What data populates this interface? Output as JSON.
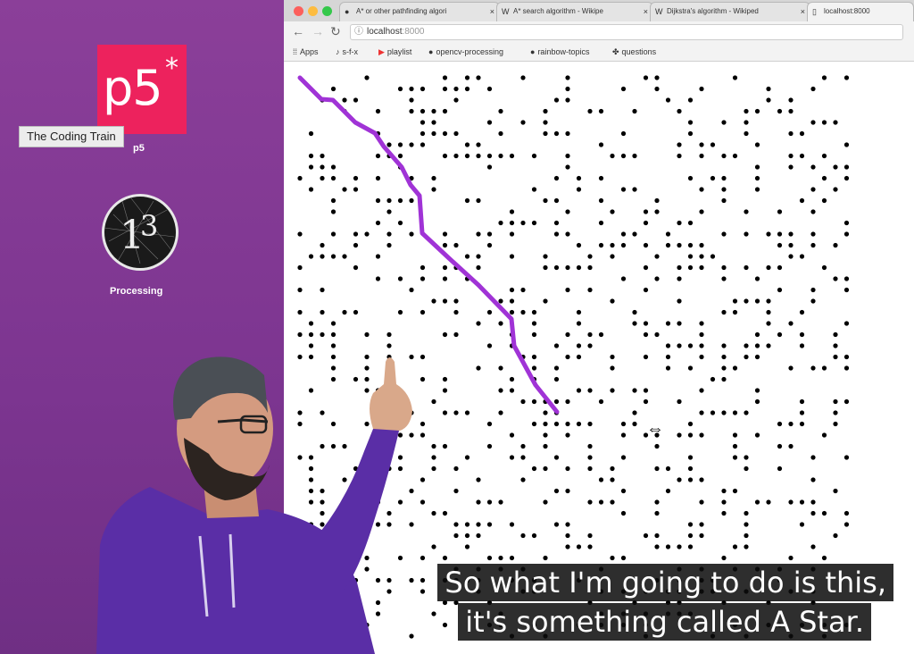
{
  "desktop": {
    "p5": {
      "logo_text": "p5",
      "logo_star": "*",
      "label": "p5"
    },
    "tooltip": "The Coding Train",
    "processing": {
      "label": "Processing"
    }
  },
  "browser": {
    "tabs": [
      {
        "label": "A* or other pathfinding algori",
        "icon": "github-icon"
      },
      {
        "label": "A* search algorithm - Wikipe",
        "icon": "wikipedia-icon"
      },
      {
        "label": "Dijkstra's algorithm - Wikiped",
        "icon": "wikipedia-icon"
      },
      {
        "label": "localhost:8000",
        "icon": "page-icon",
        "active": true
      }
    ],
    "address": {
      "host": "localhost",
      "port": ":8000"
    },
    "bookmarks": [
      {
        "label": "Apps",
        "icon": "apps-icon"
      },
      {
        "label": "s-f-x",
        "icon": "music-note-icon"
      },
      {
        "label": "playlist",
        "icon": "youtube-icon"
      },
      {
        "label": "opencv-processing",
        "icon": "github-icon"
      },
      {
        "label": "rainbow-topics",
        "icon": "github-icon"
      },
      {
        "label": "questions",
        "icon": "puzzle-icon"
      }
    ],
    "canvas": {
      "path_color": "#a033d6",
      "obstacle_color": "#000000"
    }
  },
  "captions": {
    "line1": "So what I'm going to do is this,",
    "line2": "it's something called A Star."
  }
}
